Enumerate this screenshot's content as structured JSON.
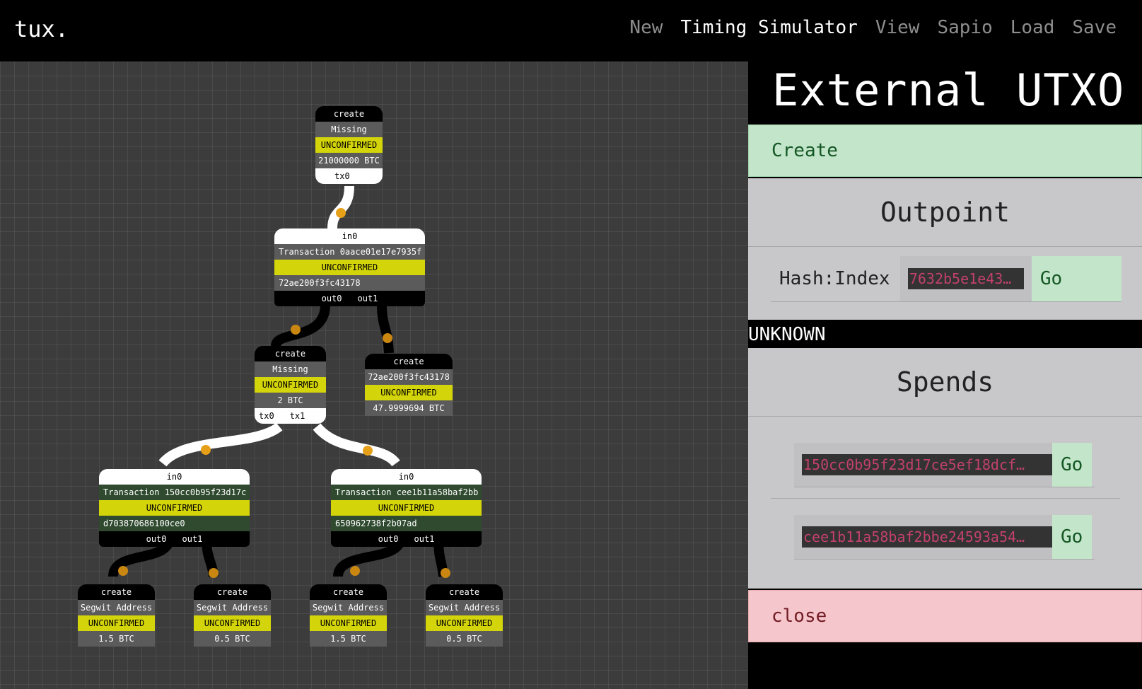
{
  "app": {
    "logo": "tux."
  },
  "nav": {
    "new": "New",
    "timing": "Timing Simulator",
    "view": "View",
    "sapio": "Sapio",
    "load": "Load",
    "save": "Save"
  },
  "graph": {
    "n1": {
      "header": "create",
      "name": "Missing",
      "status": "UNCONFIRMED",
      "amount": "21000000 BTC",
      "port0": "tx0"
    },
    "n2": {
      "header": "in0",
      "name": "Transaction  0aace01e17e7935f",
      "status": "UNCONFIRMED",
      "detail": "72ae200f3fc43178",
      "port0": "out0",
      "port1": "out1"
    },
    "n3": {
      "header": "create",
      "name": "Missing",
      "status": "UNCONFIRMED",
      "amount": "2 BTC",
      "port0": "tx0",
      "port1": "tx1"
    },
    "n4": {
      "header": "create",
      "name": "72ae200f3fc43178",
      "status": "UNCONFIRMED",
      "amount": "47.9999694 BTC"
    },
    "n5": {
      "header": "in0",
      "name": "Transaction  150cc0b95f23d17c",
      "status": "UNCONFIRMED",
      "detail": "d703870686100ce0",
      "port0": "out0",
      "port1": "out1"
    },
    "n6": {
      "header": "in0",
      "name": "Transaction  cee1b11a58baf2bb",
      "status": "UNCONFIRMED",
      "detail": "650962738f2b07ad",
      "port0": "out0",
      "port1": "out1"
    },
    "n7": {
      "header": "create",
      "name": "Segwit Address",
      "status": "UNCONFIRMED",
      "amount": "1.5 BTC"
    },
    "n8": {
      "header": "create",
      "name": "Segwit Address",
      "status": "UNCONFIRMED",
      "amount": "0.5 BTC"
    },
    "n9": {
      "header": "create",
      "name": "Segwit Address",
      "status": "UNCONFIRMED",
      "amount": "1.5 BTC"
    },
    "n10": {
      "header": "create",
      "name": "Segwit Address",
      "status": "UNCONFIRMED",
      "amount": "0.5 BTC"
    }
  },
  "panel": {
    "title": "External UTXO",
    "create_label": "Create",
    "outpoint_title": "Outpoint",
    "hash_label": "Hash:Index",
    "hash_value": "7632b5e1e43…",
    "go_label": "Go",
    "status": "UNKNOWN",
    "spends_title": "Spends",
    "spends": [
      {
        "txid": "150cc0b95f23d17ce5ef18dcf…",
        "go": "Go"
      },
      {
        "txid": "cee1b11a58baf2bbe24593a54…",
        "go": "Go"
      }
    ],
    "close_label": "close"
  },
  "colors": {
    "unconfirmed": "#d4d40a",
    "create": "#c3e6cb",
    "close": "#f5c6cb",
    "hash": "#c2416b",
    "wire_dot": "#e6a017"
  }
}
